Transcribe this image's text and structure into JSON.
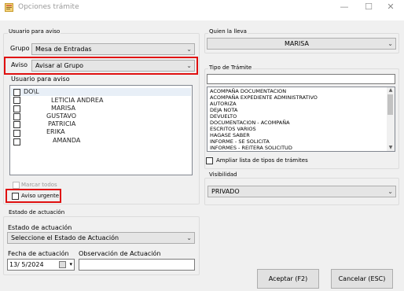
{
  "window": {
    "title": "Opciones trámite",
    "minimize_glyph": "—",
    "maximize_glyph": "☐",
    "close_glyph": "✕",
    "icon": "window-icon"
  },
  "aviso": {
    "section_title": "Usuario para aviso",
    "grupo_label": "Grupo",
    "grupo_value": "Mesa de Entradas",
    "aviso_label": "Aviso",
    "aviso_value": "Avisar al Grupo",
    "users_label": "Usuario para aviso",
    "users": [
      {
        "name": "DO\\L",
        "checked": false
      },
      {
        "name": "LETICIA ANDREA",
        "checked": false
      },
      {
        "name": "MARISA",
        "checked": false
      },
      {
        "name": "GUSTAVO",
        "checked": false
      },
      {
        "name": "PATRICIA",
        "checked": false
      },
      {
        "name": "ERIKA",
        "checked": false
      },
      {
        "name": "AMANDA",
        "checked": false
      }
    ],
    "marcar_todos": "Marcar todos",
    "urgente": "Aviso urgente"
  },
  "estado": {
    "section_title": "Estado de actuación",
    "estado_label": "Estado de actuación",
    "estado_value": "Seleccione el Estado de Actuación",
    "fecha_label": "Fecha de actuación",
    "fecha_value": "13/  5/2024",
    "obs_label": "Observación de Actuación",
    "obs_value": ""
  },
  "quien": {
    "section_title": "Quien la lleva",
    "value": "MARISA"
  },
  "tipo": {
    "section_title": "Tipo de Trámite",
    "search_value": "",
    "items": [
      "ACOMPAÑA DOCUMENTACION",
      "ACOMPAÑA EXPEDIENTE ADMINISTRATIVO",
      "AUTORIZA",
      "DEJA NOTA",
      "DEVUELTO",
      "DOCUMENTACION - ACOMPAÑA",
      "ESCRITOS VARIOS",
      "HAGASE SABER",
      "INFORME - SE SOLICITA",
      "INFORMES - REITERA SOLICITUD"
    ],
    "ampliar": "Ampliar lista de tipos de trámites"
  },
  "visibilidad": {
    "section_title": "Visibilidad",
    "value": "PRIVADO"
  },
  "buttons": {
    "accept": "Aceptar (F2)",
    "cancel": "Cancelar (ESC)"
  },
  "colors": {
    "highlight": "#e01010",
    "background": "#f0f0f0"
  }
}
